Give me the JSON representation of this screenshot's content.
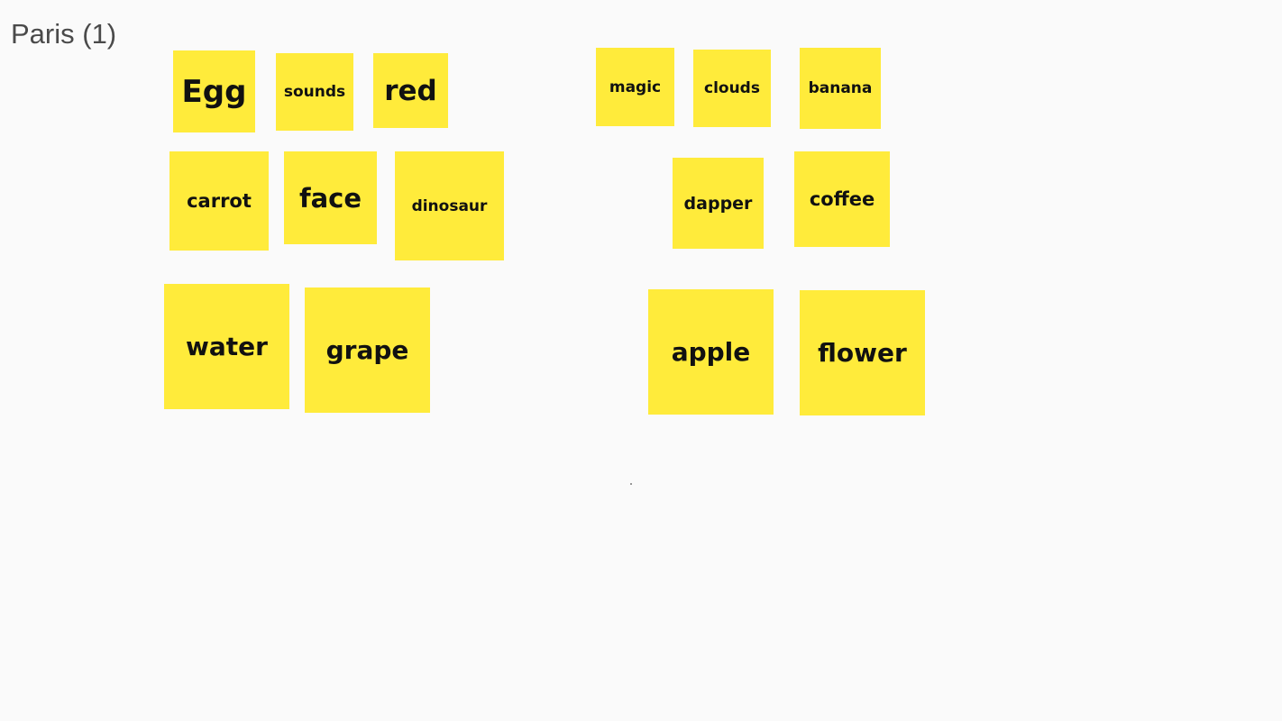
{
  "board": {
    "title": "Paris (1)",
    "note_color": "#ffeb3b",
    "background_color": "#fafafa"
  },
  "notes": {
    "egg": "Egg",
    "sounds": "sounds",
    "red": "red",
    "carrot": "carrot",
    "face": "face",
    "dinosaur": "dinosaur",
    "water": "water",
    "grape": "grape",
    "magic": "magic",
    "clouds": "clouds",
    "banana": "banana",
    "dapper": "dapper",
    "coffee": "coffee",
    "apple": "apple",
    "flower": "flower"
  }
}
